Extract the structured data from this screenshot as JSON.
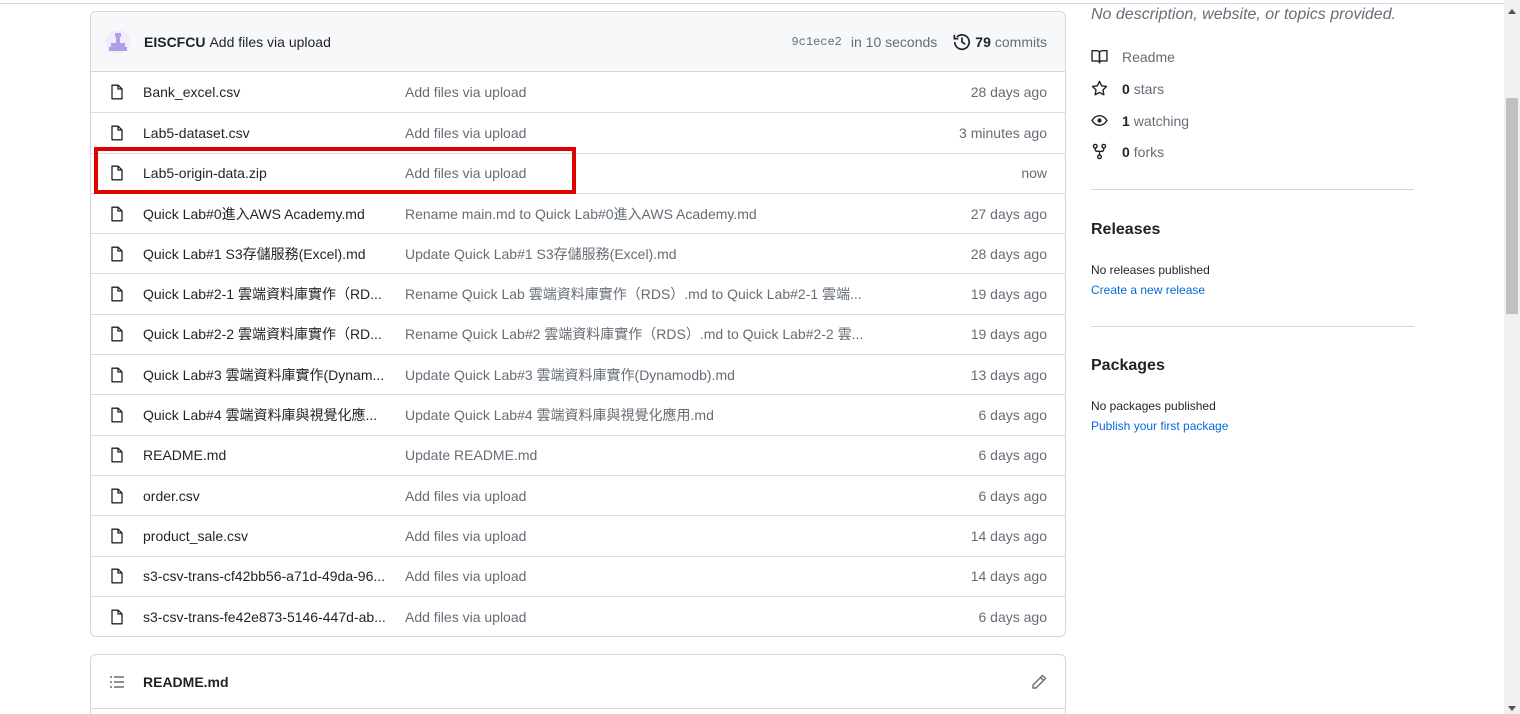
{
  "commit": {
    "author": "EISCFCU",
    "message": "Add files via upload",
    "sha": "9c1ece2",
    "time": "in 10 seconds",
    "count": "79",
    "count_label": "commits"
  },
  "files": [
    {
      "name": "Bank_excel.csv",
      "message": "Add files via upload",
      "age": "28 days ago"
    },
    {
      "name": "Lab5-dataset.csv",
      "message": "Add files via upload",
      "age": "3 minutes ago"
    },
    {
      "name": "Lab5-origin-data.zip",
      "message": "Add files via upload",
      "age": "now"
    },
    {
      "name": "Quick Lab#0進入AWS Academy.md",
      "message": "Rename main.md to Quick Lab#0進入AWS Academy.md",
      "age": "27 days ago"
    },
    {
      "name": "Quick Lab#1 S3存儲服務(Excel).md",
      "message": "Update Quick Lab#1 S3存儲服務(Excel).md",
      "age": "28 days ago"
    },
    {
      "name": "Quick Lab#2-1 雲端資料庫實作（RD...",
      "message": "Rename Quick Lab 雲端資料庫實作（RDS）.md to Quick Lab#2-1 雲端...",
      "age": "19 days ago"
    },
    {
      "name": "Quick Lab#2-2 雲端資料庫實作（RD...",
      "message": "Rename Quick Lab#2 雲端資料庫實作（RDS）.md to Quick Lab#2-2 雲...",
      "age": "19 days ago"
    },
    {
      "name": "Quick Lab#3 雲端資料庫實作(Dynam...",
      "message": "Update Quick Lab#3 雲端資料庫實作(Dynamodb).md",
      "age": "13 days ago"
    },
    {
      "name": "Quick Lab#4 雲端資料庫與視覺化應...",
      "message": "Update Quick Lab#4 雲端資料庫與視覺化應用.md",
      "age": "6 days ago"
    },
    {
      "name": "README.md",
      "message": "Update README.md",
      "age": "6 days ago"
    },
    {
      "name": "order.csv",
      "message": "Add files via upload",
      "age": "6 days ago"
    },
    {
      "name": "product_sale.csv",
      "message": "Add files via upload",
      "age": "14 days ago"
    },
    {
      "name": "s3-csv-trans-cf42bb56-a71d-49da-96...",
      "message": "Add files via upload",
      "age": "14 days ago"
    },
    {
      "name": "s3-csv-trans-fe42e873-5146-447d-ab...",
      "message": "Add files via upload",
      "age": "6 days ago"
    }
  ],
  "readme": {
    "title": "README.md"
  },
  "sidebar": {
    "description": "No description, website, or topics provided.",
    "readme_label": "Readme",
    "stars_count": "0",
    "stars_label": "stars",
    "watching_count": "1",
    "watching_label": "watching",
    "forks_count": "0",
    "forks_label": "forks",
    "releases_title": "Releases",
    "releases_text": "No releases published",
    "releases_link": "Create a new release",
    "packages_title": "Packages",
    "packages_text": "No packages published",
    "packages_link": "Publish your first package"
  },
  "icons": {
    "avatar": "identicon-avatar",
    "file": "file-icon",
    "history": "history-icon",
    "list": "list-icon",
    "pencil": "pencil-icon",
    "book": "book-icon",
    "star": "star-icon",
    "eye": "eye-icon",
    "fork": "fork-icon"
  },
  "colors": {
    "highlight": "#e00000",
    "link": "#0969da",
    "muted": "#656d76",
    "avatar": "#b19ee8"
  }
}
